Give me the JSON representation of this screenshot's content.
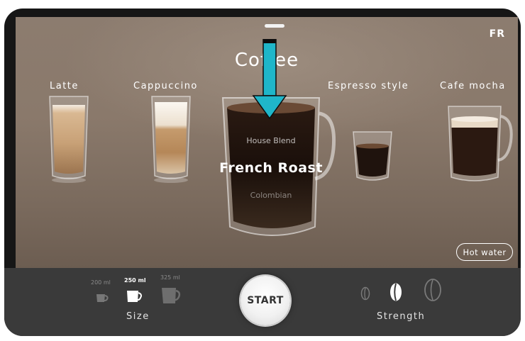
{
  "app": {
    "language": "FR",
    "category_title": "Coffee"
  },
  "drinks": [
    {
      "label": "Latte"
    },
    {
      "label": "Cappuccino"
    },
    {
      "label": "Espresso style"
    },
    {
      "label": "Cafe mocha"
    }
  ],
  "roast_selector": {
    "previous": "House Blend",
    "selected": "French Roast",
    "next": "Colombian"
  },
  "hot_water_label": "Hot water",
  "size": {
    "label": "Size",
    "options": [
      {
        "value": "200 ml"
      },
      {
        "value": "250 ml"
      },
      {
        "value": "325 ml"
      }
    ],
    "selected": "250 ml"
  },
  "start_label": "START",
  "strength": {
    "label": "Strength",
    "levels": 3,
    "selected_level": 2
  },
  "colors": {
    "overlay_arrow": "#1fb6c9",
    "panel_bg": "#3a3a3a"
  }
}
